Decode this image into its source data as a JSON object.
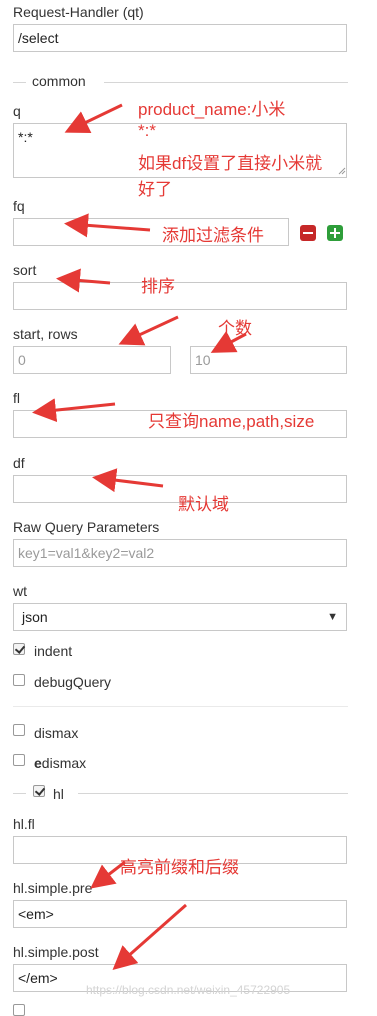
{
  "request_handler": {
    "label": "Request-Handler (qt)",
    "value": "/select"
  },
  "common_legend": "common",
  "q": {
    "label": "q",
    "value": "*:*"
  },
  "fq": {
    "label": "fq",
    "value": ""
  },
  "sort": {
    "label": "sort",
    "value": ""
  },
  "start_rows": {
    "label": "start, rows",
    "start_value": "0",
    "rows_value": "10"
  },
  "fl": {
    "label": "fl",
    "value": ""
  },
  "df": {
    "label": "df",
    "value": ""
  },
  "raw_query": {
    "label": "Raw Query Parameters",
    "placeholder": "key1=val1&key2=val2"
  },
  "wt": {
    "label": "wt",
    "selected": "json",
    "arrow": "▼"
  },
  "indent": {
    "label": "indent",
    "checked": true
  },
  "debug_query": {
    "label": "debugQuery",
    "checked": false
  },
  "dismax": {
    "label": "dismax",
    "checked": false
  },
  "edismax": {
    "label_bold": "e",
    "label_rest": "dismax",
    "checked": false
  },
  "hl": {
    "label": "hl",
    "checked": true
  },
  "hl_fl": {
    "label": "hl.fl",
    "value": ""
  },
  "hl_simple_pre": {
    "label": "hl.simple.pre",
    "value": "<em>"
  },
  "hl_simple_post": {
    "label": "hl.simple.post",
    "value": "</em>"
  },
  "annotations": {
    "q_line1": "product_name:小米",
    "q_line2": "*:*",
    "q_line3": "如果df设置了直接小米就",
    "q_line4": "好了",
    "fq": "添加过滤条件",
    "sort": "排序",
    "rows": "个数",
    "fl": "只查询name,path,size",
    "df": "默认域",
    "hl_pre": "高亮前缀和后缀"
  },
  "watermark": "https://blog.csdn.net/weixin_45722905",
  "colors": {
    "annotation": "#e53935",
    "remove_btn": "#c62828",
    "add_btn": "#2e9e3a"
  }
}
